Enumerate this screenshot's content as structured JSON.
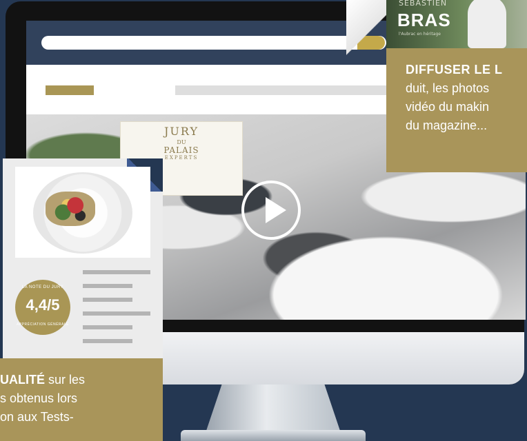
{
  "video": {
    "banner_line1": "JURY",
    "banner_line2": "DU",
    "banner_line3": "PALAIS",
    "banner_line4": "EXPERTS",
    "play_icon": "play-icon"
  },
  "magazine": {
    "firstname": "SÉBASTIEN",
    "lastname": "BRAS",
    "subtitle": "l'Aubrac en héritage"
  },
  "right_box": {
    "title": "DIFFUSER LE L",
    "line1": "duit, les photos",
    "line2": "vidéo du makin",
    "line3": "du magazine..."
  },
  "report_card": {
    "badge_top": "LA NOTE DU JURY",
    "badge_score": "4,4/5",
    "badge_bottom": "APPRÉCIATION GÉNÉRALE"
  },
  "left_box": {
    "title": "UALITÉ",
    "title_rest": " sur les",
    "line1": "s obtenus lors",
    "line2": "on aux Tests-"
  },
  "colors": {
    "background": "#243752",
    "gold": "#a9955a",
    "browser_bar": "#31425c"
  }
}
